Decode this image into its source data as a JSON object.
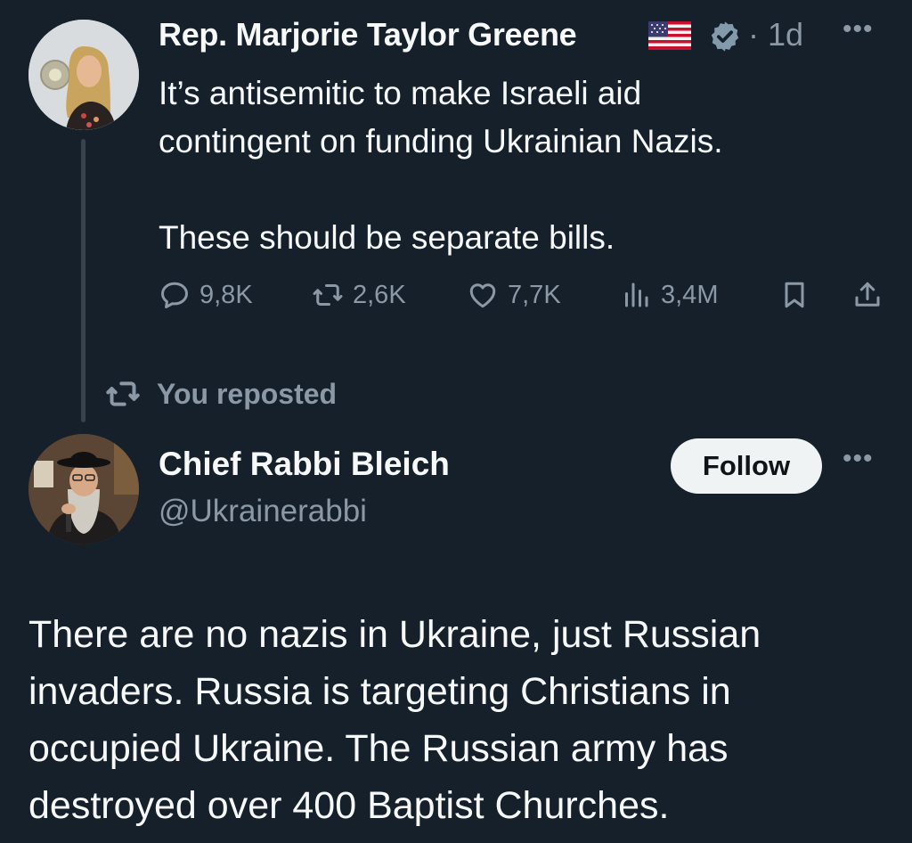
{
  "tweet1": {
    "author_name": "Rep. Marjorie Taylor Greene",
    "time": "· 1d",
    "more": "•••",
    "text": "It’s antisemitic to make Israeli aid\ncontingent on funding Ukrainian Nazis.\n\nThese should be separate bills.",
    "actions": {
      "replies": "9,8K",
      "reposts": "2,6K",
      "likes": "7,7K",
      "views": "3,4M"
    },
    "icons": [
      "us-flag-icon",
      "verified-badge-icon",
      "reply-icon",
      "retweet-icon",
      "heart-icon",
      "views-icon",
      "bookmark-icon",
      "share-icon"
    ]
  },
  "repost_notice": {
    "label": "You reposted"
  },
  "tweet2": {
    "author_name": "Chief Rabbi Bleich",
    "handle": "@Ukrainerabbi",
    "follow_label": "Follow",
    "more": "•••",
    "text": "There are no nazis in Ukraine, just Russian invaders. Russia is targeting Christians in occupied Ukraine. The Russian army has destroyed over 400 Baptist Churches."
  },
  "colors": {
    "background": "#15202b",
    "text": "#f7f9f9",
    "muted": "#8b98a5",
    "button_bg": "#eff3f4"
  }
}
